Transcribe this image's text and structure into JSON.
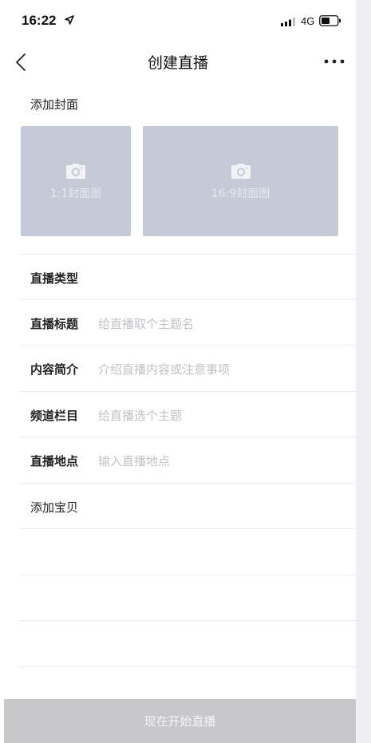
{
  "status_bar": {
    "time": "16:22",
    "network": "4G"
  },
  "nav": {
    "title": "创建直播",
    "back_icon": "chevron-left-icon",
    "more_icon": "ellipsis-icon"
  },
  "cover": {
    "label": "添加封面",
    "tiles": [
      {
        "caption": "1:1封面图",
        "icon": "camera-icon"
      },
      {
        "caption": "16:9封面图",
        "icon": "camera-icon"
      }
    ]
  },
  "form": {
    "rows": [
      {
        "label": "直播类型",
        "placeholder": ""
      },
      {
        "label": "直播标题",
        "placeholder": "给直播取个主题名"
      },
      {
        "label": "内容简介",
        "placeholder": "介绍直播内容或注意事项"
      },
      {
        "label": "频道栏目",
        "placeholder": "给直播选个主题"
      },
      {
        "label": "直播地点",
        "placeholder": "输入直播地点"
      },
      {
        "label": "添加宝贝",
        "placeholder": ""
      }
    ]
  },
  "footer": {
    "start_label": "现在开始直播"
  },
  "colors": {
    "cover_tile": "#c6cad7",
    "button_disabled": "#c8c8ca",
    "placeholder": "#c2c2c6"
  }
}
